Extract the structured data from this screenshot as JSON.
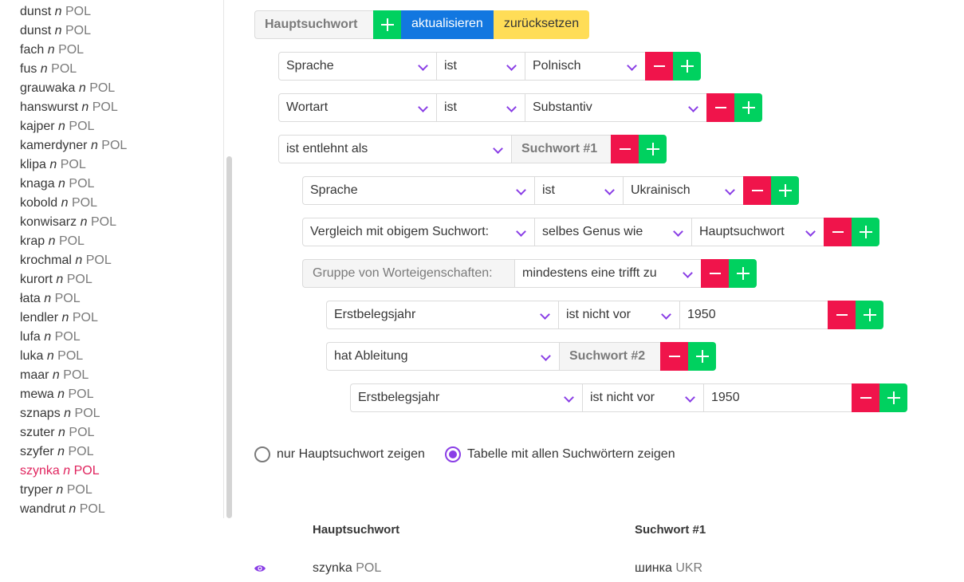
{
  "sidebar": {
    "words": [
      {
        "word": "dunst",
        "pos": "n",
        "lang": "POL"
      },
      {
        "word": "dunst",
        "pos": "n",
        "lang": "POL"
      },
      {
        "word": "fach",
        "pos": "n",
        "lang": "POL"
      },
      {
        "word": "fus",
        "pos": "n",
        "lang": "POL"
      },
      {
        "word": "grauwaka",
        "pos": "n",
        "lang": "POL"
      },
      {
        "word": "hanswurst",
        "pos": "n",
        "lang": "POL"
      },
      {
        "word": "kajper",
        "pos": "n",
        "lang": "POL"
      },
      {
        "word": "kamerdyner",
        "pos": "n",
        "lang": "POL"
      },
      {
        "word": "klipa",
        "pos": "n",
        "lang": "POL"
      },
      {
        "word": "knaga",
        "pos": "n",
        "lang": "POL"
      },
      {
        "word": "kobold",
        "pos": "n",
        "lang": "POL"
      },
      {
        "word": "konwisarz",
        "pos": "n",
        "lang": "POL"
      },
      {
        "word": "krap",
        "pos": "n",
        "lang": "POL"
      },
      {
        "word": "krochmal",
        "pos": "n",
        "lang": "POL"
      },
      {
        "word": "kurort",
        "pos": "n",
        "lang": "POL"
      },
      {
        "word": "łata",
        "pos": "n",
        "lang": "POL"
      },
      {
        "word": "lendler",
        "pos": "n",
        "lang": "POL"
      },
      {
        "word": "lufa",
        "pos": "n",
        "lang": "POL"
      },
      {
        "word": "luka",
        "pos": "n",
        "lang": "POL"
      },
      {
        "word": "maar",
        "pos": "n",
        "lang": "POL"
      },
      {
        "word": "mewa",
        "pos": "n",
        "lang": "POL"
      },
      {
        "word": "sznaps",
        "pos": "n",
        "lang": "POL"
      },
      {
        "word": "szuter",
        "pos": "n",
        "lang": "POL"
      },
      {
        "word": "szyfer",
        "pos": "n",
        "lang": "POL"
      },
      {
        "word": "szynka",
        "pos": "n",
        "lang": "POL",
        "active": true
      },
      {
        "word": "tryper",
        "pos": "n",
        "lang": "POL"
      },
      {
        "word": "wandrut",
        "pos": "n",
        "lang": "POL"
      }
    ]
  },
  "toolbar": {
    "main_label": "Hauptsuchwort",
    "update_label": "aktualisieren",
    "reset_label": "zurücksetzen"
  },
  "conditions": {
    "r1": {
      "field": "Sprache",
      "op": "ist",
      "value": "Polnisch"
    },
    "r2": {
      "field": "Wortart",
      "op": "ist",
      "value": "Substantiv"
    },
    "r3": {
      "field": "ist entlehnt als",
      "target": "Suchwort #1"
    },
    "r4": {
      "field": "Sprache",
      "op": "ist",
      "value": "Ukrainisch"
    },
    "r5": {
      "field": "Vergleich mit obigem Suchwort:",
      "op": "selbes Genus wie",
      "value": "Hauptsuchwort"
    },
    "r6": {
      "field": "Gruppe von Worteigenschaften:",
      "op": "mindestens eine trifft zu"
    },
    "r7": {
      "field": "Erstbelegsjahr",
      "op": "ist nicht vor",
      "value": "1950"
    },
    "r8": {
      "field": "hat Ableitung",
      "target": "Suchwort #2"
    },
    "r9": {
      "field": "Erstbelegsjahr",
      "op": "ist nicht vor",
      "value": "1950"
    }
  },
  "display": {
    "option_main": "nur Hauptsuchwort zeigen",
    "option_table": "Tabelle mit allen Suchwörtern zeigen",
    "selected": "table"
  },
  "results": {
    "headers": [
      "Hauptsuchwort",
      "Suchwort #1"
    ],
    "rows": [
      {
        "main_word": "szynka",
        "main_lang": "POL",
        "s1_word": "шинка",
        "s1_lang": "UKR"
      }
    ]
  },
  "colors": {
    "accent": "#8a3ee6",
    "minus": "#f0144b",
    "plus": "#00d15f",
    "update": "#1277e0",
    "reset": "#ffdd57",
    "active_word": "#e0245e"
  }
}
